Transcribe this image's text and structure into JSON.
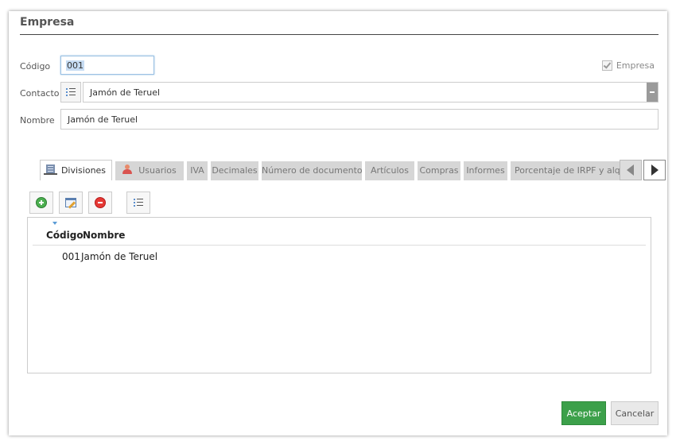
{
  "dialog": {
    "title": "Empresa",
    "fields": {
      "codigo_label": "Código",
      "codigo_value": "001",
      "contacto_label": "Contacto",
      "contacto_value": "Jamón de Teruel",
      "nombre_label": "Nombre",
      "nombre_value": "Jamón de Teruel",
      "empresa_checkbox_label": "Empresa",
      "empresa_checked": true
    },
    "tabs": [
      {
        "label": "Divisiones",
        "icon": "building-icon",
        "active": true
      },
      {
        "label": "Usuarios",
        "icon": "user-icon",
        "active": false
      },
      {
        "label": "IVA",
        "active": false
      },
      {
        "label": "Decimales",
        "active": false
      },
      {
        "label": "Número de documentos",
        "active": false
      },
      {
        "label": "Artículos",
        "active": false
      },
      {
        "label": "Compras",
        "active": false
      },
      {
        "label": "Informes",
        "active": false
      },
      {
        "label": "Porcentaje de IRPF y alqu",
        "active": false
      }
    ],
    "grid": {
      "columns": [
        "Código",
        "Nombre"
      ],
      "rows": [
        {
          "codigo": "001",
          "nombre": "Jamón de Teruel"
        }
      ]
    },
    "buttons": {
      "accept": "Aceptar",
      "cancel": "Cancelar"
    },
    "colors": {
      "accept_bg": "#3ca04a",
      "focus_border": "#9ac1e3"
    }
  }
}
